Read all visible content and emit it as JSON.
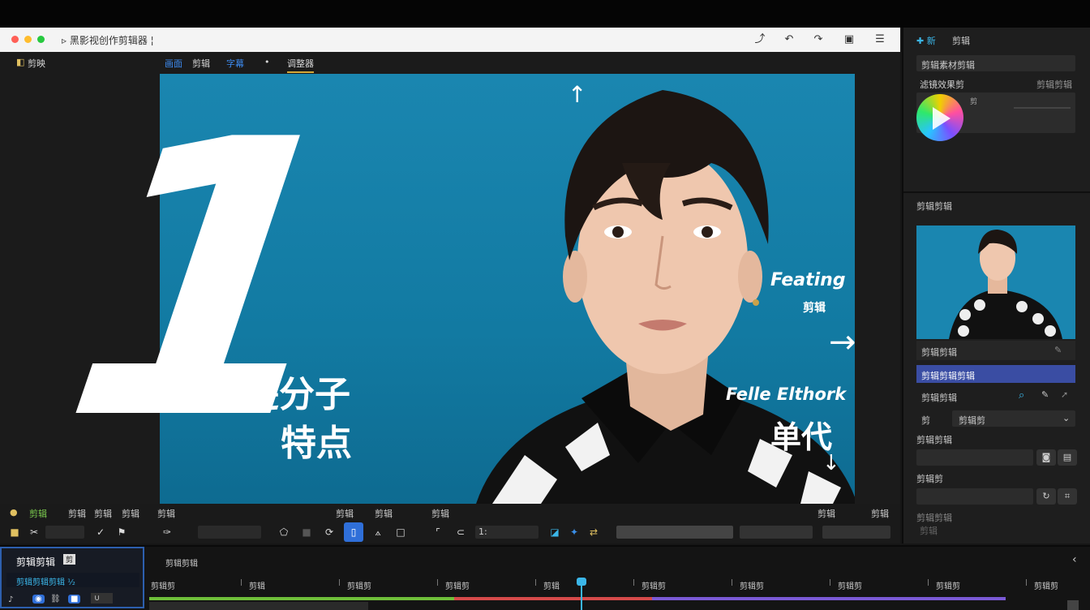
{
  "titlebar": {
    "title": "▹ 黑影视创作剪辑器 ¦"
  },
  "topnav": {
    "app_label": "剪映",
    "items": [
      "画面",
      "剪辑",
      "字幕",
      "•",
      "调整器"
    ]
  },
  "canvas": {
    "big_number": "1",
    "cn_line1": "遊分子",
    "cn_line2": "特点",
    "en_right1": "Feating",
    "cn_right1": "剪辑",
    "en_right2": "Felle Elthork",
    "cn_right2": "单代",
    "arrow_right": "→",
    "arrow_down": "↓",
    "cursor": "↑"
  },
  "right_panel": {
    "tab_add": "✚ 新",
    "tab_label": "剪辑",
    "field1": "剪辑素材剪辑",
    "section1_label": "滤镜效果剪",
    "section1_right": "剪辑剪辑",
    "section1_badge": "剪",
    "section2_label": "剪辑剪辑",
    "preview_caption": "剪辑剪辑",
    "highlight_row": "剪辑剪辑剪辑",
    "row_search_label": "剪辑剪辑",
    "row_select_label": "剪",
    "row_select_value": "剪辑剪",
    "row3_label": "剪辑剪辑",
    "row4_label": "剪辑剪",
    "row5_label": "剪辑剪辑",
    "row6_label": "剪辑"
  },
  "toolbar": {
    "left_label": "剪辑",
    "items": [
      "剪辑",
      "剪辑",
      "剪辑",
      "剪辑",
      "剪辑",
      "剪辑",
      "剪辑",
      "剪辑"
    ],
    "zoom_value": "1:"
  },
  "timeline": {
    "left_title": "剪辑剪辑",
    "left_badge": "剪",
    "left_sub": "剪辑剪辑剪辑 ¹⁄₂",
    "track_header": "剪辑剪辑",
    "ruler_labels": [
      "剪辑剪",
      "剪辑",
      "剪辑剪",
      "剪辑剪",
      "剪辑",
      "剪辑剪",
      "剪辑剪",
      "剪辑剪",
      "剪辑剪",
      "剪辑剪"
    ]
  },
  "colors": {
    "canvas_blue": "#1a86b0",
    "accent_blue": "#2f6fd9",
    "track_green": "#6fbf3a",
    "track_red": "#d64a4a",
    "track_purple": "#7b5ad6",
    "playhead": "#3bb6e8"
  }
}
